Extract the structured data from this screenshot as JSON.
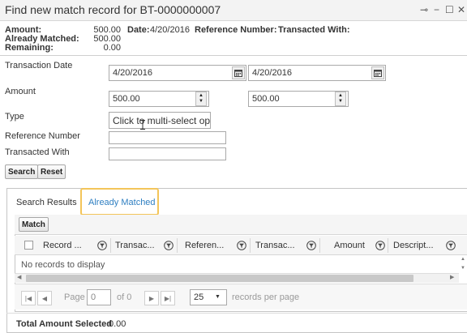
{
  "window": {
    "title": "Find new match record for BT-0000000007",
    "pin_glyph": "⊸",
    "minimize_glyph": "−",
    "maximize_glyph": "☐",
    "close_glyph": "✕"
  },
  "summary": {
    "amount_label": "Amount:",
    "amount_value": "500.00",
    "already_matched_label": "Already Matched:",
    "already_matched_value": "500.00",
    "remaining_label": "Remaining:",
    "remaining_value": "0.00",
    "date_label": "Date:",
    "date_value": "4/20/2016",
    "reference_number_label": "Reference Number:",
    "transacted_with_label": "Transacted With:"
  },
  "form": {
    "transaction_date_label": "Transaction Date",
    "date_from": "4/20/2016",
    "date_to": "4/20/2016",
    "amount_label": "Amount",
    "amount_from": "500.00",
    "amount_to": "500.00",
    "type_label": "Type",
    "type_placeholder": "Click to multi-select optio",
    "reference_number_label": "Reference Number",
    "transacted_with_label": "Transacted With",
    "search_button": "Search",
    "reset_button": "Reset"
  },
  "tabs": [
    {
      "label": "Search Results",
      "active": false
    },
    {
      "label": "Already Matched",
      "active": true
    }
  ],
  "grid": {
    "match_button": "Match",
    "columns": [
      "Record ...",
      "Transac...",
      "Referen...",
      "Transac...",
      "Amount",
      "Descript..."
    ],
    "empty_message": "No records to display",
    "pager": {
      "page_label": "Page",
      "page_value": "0",
      "of_label": "of 0",
      "page_size": "25",
      "records_per_page_label": "records per page"
    }
  },
  "footer": {
    "total_label": "Total Amount Selected",
    "total_value": "0.00"
  },
  "colors": {
    "highlight_border": "#f3c55a",
    "active_tab_text": "#2f7fc1",
    "panel_border": "#c5c5c5"
  },
  "icons": [
    "pin-icon",
    "minimize-icon",
    "maximize-icon",
    "close-icon",
    "calendar-icon",
    "spinner-up-icon",
    "spinner-down-icon",
    "filter-icon",
    "checkbox-icon",
    "first-page-icon",
    "prev-page-icon",
    "next-page-icon",
    "last-page-icon",
    "dropdown-caret-icon",
    "text-cursor-icon"
  ]
}
